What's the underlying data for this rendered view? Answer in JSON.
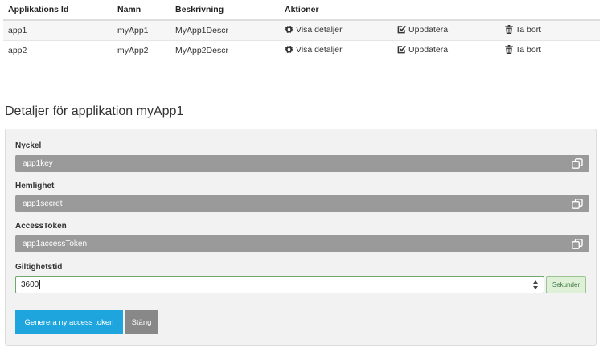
{
  "table": {
    "headers": [
      "Applikations Id",
      "Namn",
      "Beskrivning",
      "Aktioner"
    ],
    "rows": [
      {
        "id": "app1",
        "name": "myApp1",
        "description": "MyApp1Descr",
        "show_label": "Visa detaljer",
        "update_label": "Uppdatera",
        "delete_label": "Ta bort"
      },
      {
        "id": "app2",
        "name": "myApp2",
        "description": "MyApp2Descr",
        "show_label": "Visa detaljer",
        "update_label": "Uppdatera",
        "delete_label": "Ta bort"
      }
    ],
    "icons": {
      "show": "gear-icon",
      "update": "edit-check-icon",
      "delete": "trash-icon"
    }
  },
  "details": {
    "title": "Detaljer för applikation myApp1",
    "key": {
      "label": "Nyckel",
      "value": "app1key"
    },
    "secret": {
      "label": "Hemlighet",
      "value": "app1secret"
    },
    "token": {
      "label": "AccessToken",
      "value": "app1accessToken"
    },
    "validity": {
      "label": "Giltighetstid",
      "value": "3600",
      "unit": "Sekunder"
    },
    "generate_button": "Generera ny access token",
    "close_button": "Stäng",
    "copy_icon": "copy-icon"
  },
  "colors": {
    "primary": "#1ea5dd",
    "secondary": "#888888",
    "readonly_field": "#9a9a9a",
    "panel_bg": "#f2f2f2",
    "success_bg": "#dff0d8"
  }
}
